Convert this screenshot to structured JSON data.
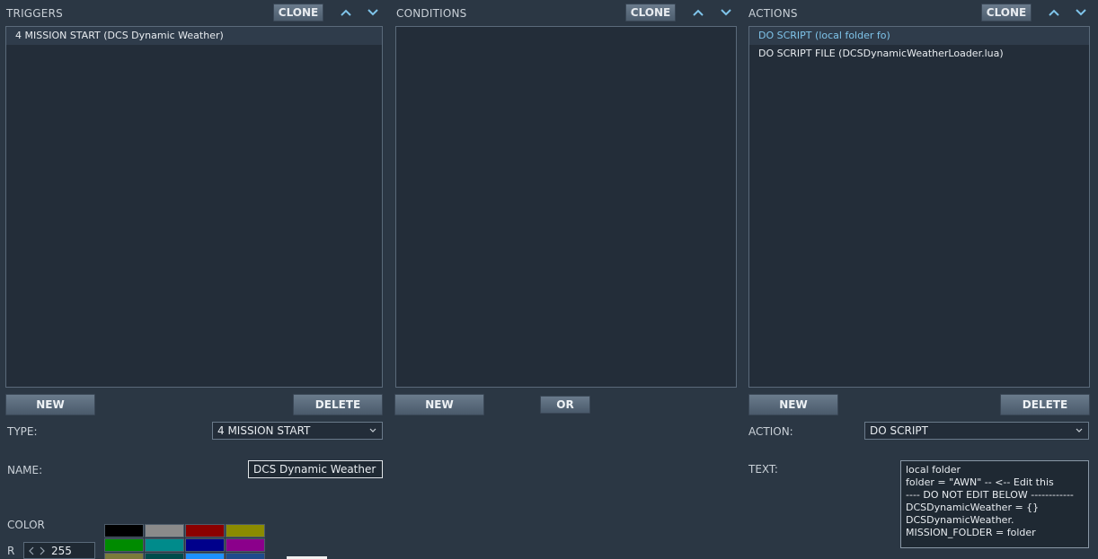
{
  "triggers": {
    "title": "TRIGGERS",
    "clone_label": "CLONE",
    "items": [
      "4 MISSION START (DCS Dynamic Weather)"
    ],
    "new_label": "NEW",
    "delete_label": "DELETE",
    "type_label": "TYPE:",
    "type_value": "4 MISSION START",
    "name_label": "NAME:",
    "name_value": "DCS Dynamic Weather",
    "color_label": "COLOR",
    "r_label": "R",
    "r_value": "255",
    "swatches": [
      "#000000",
      "#8a8a8a",
      "#8b0000",
      "#8b8b00",
      "#008b00",
      "#008b8b",
      "#00008b",
      "#8b008b",
      "#7b7b3b",
      "#004b4b",
      "#1e90ff",
      "#1e4b8b"
    ]
  },
  "conditions": {
    "title": "CONDITIONS",
    "clone_label": "CLONE",
    "new_label": "NEW",
    "or_label": "OR"
  },
  "actions": {
    "title": "ACTIONS",
    "clone_label": "CLONE",
    "items": [
      "DO SCRIPT (local folder fo)",
      "DO SCRIPT FILE (DCSDynamicWeatherLoader.lua)"
    ],
    "new_label": "NEW",
    "delete_label": "DELETE",
    "action_label": "ACTION:",
    "action_value": "DO SCRIPT",
    "text_label": "TEXT:",
    "text_value": "local folder\nfolder = \"AWN\" -- <-- Edit this\n---- DO NOT EDIT BELOW ------------\nDCSDynamicWeather = {}\nDCSDynamicWeather.\nMISSION_FOLDER = folder"
  },
  "colors": {
    "accent": "#7fc4ea",
    "background": "#2b3744",
    "list_bg": "#232d39"
  }
}
